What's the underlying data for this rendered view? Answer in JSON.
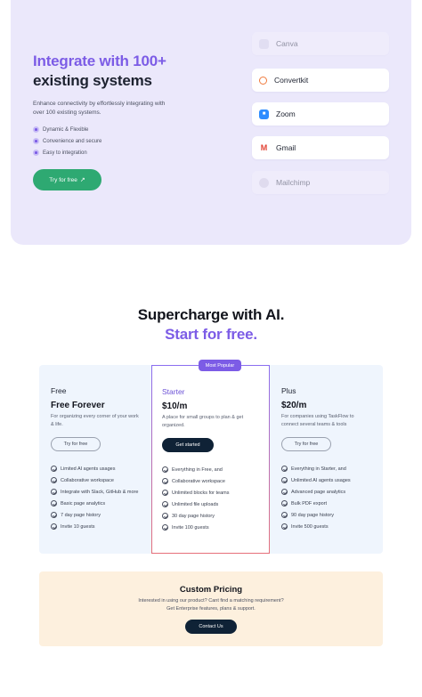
{
  "hero": {
    "title_accent": "Integrate with 100+",
    "title_rest": "existing systems",
    "description": "Enhance connectivity by effortlessly integrating with over 100 existing systems.",
    "features": [
      "Dynamic & Flexible",
      "Convenience and secure",
      "Easy to integration"
    ],
    "cta_label": "Try for free",
    "cta_icon": "arrow-up-right-icon"
  },
  "integrations": [
    {
      "name": "Canva",
      "logo_text": "",
      "icon": "canva-logo-icon",
      "faded": true
    },
    {
      "name": "Convertkit",
      "logo_text": "",
      "icon": "convertkit-logo-icon",
      "faded": false
    },
    {
      "name": "Zoom",
      "logo_text": "■",
      "icon": "zoom-logo-icon",
      "faded": false
    },
    {
      "name": "Gmail",
      "logo_text": "M",
      "icon": "gmail-logo-icon",
      "faded": false
    },
    {
      "name": "Mailchimp",
      "logo_text": "",
      "icon": "mailchimp-logo-icon",
      "faded": true
    }
  ],
  "pricing": {
    "heading_line1": "Supercharge with AI.",
    "heading_line2": "Start for free.",
    "badge": "Most Popular",
    "plans": [
      {
        "name": "Free",
        "price": "Free Forever",
        "description": "For organizing every corner of your work & life.",
        "button": "Try for free",
        "features": [
          "Limited AI agents usages",
          "Collaborative workspace",
          "Integrate with Slack, GitHub & more",
          "Basic page analytics",
          "7 day page history",
          "Invite 10 guests"
        ]
      },
      {
        "name": "Starter",
        "price": "$10/m",
        "description": "A place for small groups to plan & get organized.",
        "button": "Get started",
        "features": [
          "Everything in Free, and",
          "Collaborative workspace",
          "Unlimited blocks for teams",
          "Unlimited file uploads",
          "30 day page history",
          "Invite 100 guests"
        ]
      },
      {
        "name": "Plus",
        "price": "$20/m",
        "description": "For companies using TaskFlow to connect several teams & tools",
        "button": "Try for free",
        "features": [
          "Everything in Starter, and",
          "Unlimited AI agents usages",
          "Advanced page analytics",
          "Bulk PDF export",
          "90 day page history",
          "Invite 500 guests"
        ]
      }
    ]
  },
  "custom": {
    "title": "Custom Pricing",
    "description_line1": "Interested in using our product? Cant find a matching requirement?",
    "description_line2": "Get Enterprise features, plans & support.",
    "button": "Contact Us"
  },
  "colors": {
    "accent": "#7c5ce6",
    "cta_green": "#2ea972",
    "dark_button": "#0f2236",
    "hero_bg": "#ebe8fb",
    "plans_bg": "#eff5fd",
    "custom_bg": "#fdf0de"
  }
}
